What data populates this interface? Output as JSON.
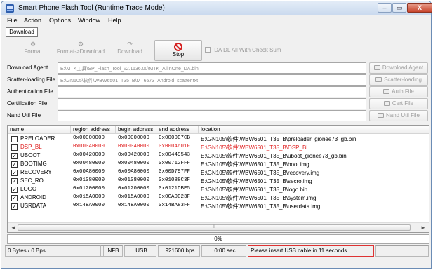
{
  "window": {
    "title": "Smart Phone Flash Tool (Runtime Trace Mode)",
    "controls": {
      "minimize": "–",
      "maximize": "▭",
      "close": "X"
    }
  },
  "menu": [
    "File",
    "Action",
    "Options",
    "Window",
    "Help"
  ],
  "tabs": {
    "active": "Download"
  },
  "toolbar": {
    "format": "Format",
    "format_download": "Format->Download",
    "download": "Download",
    "stop": "Stop",
    "da_check": "DA DL All With Check Sum"
  },
  "files": [
    {
      "label": "Download Agent",
      "value": "E:\\MTK工具\\SP_Flash_Tool_v2.1136.00\\MTK_AllInOne_DA.bin",
      "button": "Download Agent"
    },
    {
      "label": "Scatter-loading File",
      "value": "E:\\GN105\\软件\\WBW6501_T35_B\\MT6573_Android_scatter.txt",
      "button": "Scatter-loading"
    },
    {
      "label": "Authentication File",
      "value": "",
      "button": "Auth File"
    },
    {
      "label": "Certification File",
      "value": "",
      "button": "Cert File"
    },
    {
      "label": "Nand Util File",
      "value": "",
      "button": "Nand Util File"
    }
  ],
  "table": {
    "columns": [
      "name",
      "region address",
      "begin address",
      "end address",
      "location"
    ],
    "rows": [
      {
        "checked": false,
        "red": false,
        "name": "PRELOADER",
        "region": "0x00000000",
        "begin": "0x00000000",
        "end": "0x0000E7CB",
        "location": "E:\\GN105\\软件\\WBW6501_T35_B\\preloader_gionee73_gb.bin"
      },
      {
        "checked": false,
        "red": true,
        "name": "DSP_BL",
        "region": "0x00040000",
        "begin": "0x00040000",
        "end": "0x0004601F",
        "location": "E:\\GN105\\软件\\WBW6501_T35_B\\DSP_BL"
      },
      {
        "checked": true,
        "red": false,
        "name": "UBOOT",
        "region": "0x00420000",
        "begin": "0x00420000",
        "end": "0x00449543",
        "location": "E:\\GN105\\软件\\WBW6501_T35_B\\uboot_gionee73_gb.bin"
      },
      {
        "checked": true,
        "red": false,
        "name": "BOOTIMG",
        "region": "0x00480000",
        "begin": "0x00480000",
        "end": "0x00712FFF",
        "location": "E:\\GN105\\软件\\WBW6501_T35_B\\boot.img"
      },
      {
        "checked": true,
        "red": false,
        "name": "RECOVERY",
        "region": "0x00A80000",
        "begin": "0x00A80000",
        "end": "0x00D797FF",
        "location": "E:\\GN105\\软件\\WBW6501_T35_B\\recovery.img"
      },
      {
        "checked": true,
        "red": false,
        "name": "SEC_RO",
        "region": "0x01080000",
        "begin": "0x01080000",
        "end": "0x01088C3F",
        "location": "E:\\GN105\\软件\\WBW6501_T35_B\\secro.img"
      },
      {
        "checked": true,
        "red": false,
        "name": "LOGO",
        "region": "0x01200000",
        "begin": "0x01200000",
        "end": "0x0121DBE5",
        "location": "E:\\GN105\\软件\\WBW6501_T35_B\\logo.bin"
      },
      {
        "checked": true,
        "red": false,
        "name": "ANDROID",
        "region": "0x015A0000",
        "begin": "0x015A0000",
        "end": "0x0CA0C23F",
        "location": "E:\\GN105\\软件\\WBW6501_T35_B\\system.img"
      },
      {
        "checked": true,
        "red": false,
        "name": "USRDATA",
        "region": "0x14BA0000",
        "begin": "0x14BA0000",
        "end": "0x14BA83FF",
        "location": "E:\\GN105\\软件\\WBW6501_T35_B\\userdata.img"
      }
    ],
    "scroll_grip": "III"
  },
  "progress": {
    "text": "0%",
    "value": 0
  },
  "status": {
    "rate": "0 Bytes / 0 Bps",
    "blank": "",
    "storage": "NFB",
    "port": "USB",
    "baud": "921600 bps",
    "time": "0:00 sec",
    "message": "Please insert USB cable in 11 seconds"
  },
  "colors": {
    "error_red": "#e02020",
    "highlight_border": "#dd3333"
  }
}
